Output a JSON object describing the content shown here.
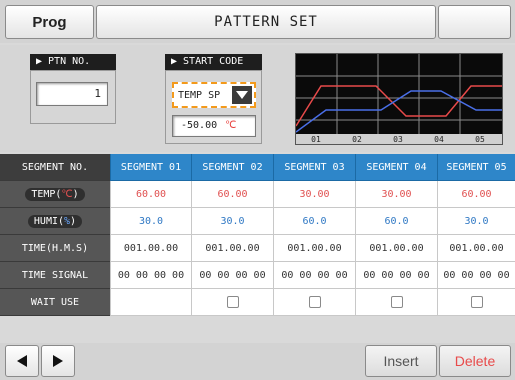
{
  "header": {
    "prog_label": "Prog",
    "title": "PATTERN SET"
  },
  "ptn": {
    "label": "▶ PTN NO.",
    "value": "1"
  },
  "start_code": {
    "label": "▶ START CODE",
    "selected": "TEMP SP",
    "temp_value": "-50.00",
    "temp_unit": "℃"
  },
  "graph": {
    "x_labels": [
      "01",
      "02",
      "03",
      "04",
      "05"
    ],
    "colors": {
      "temp": "#e84a4a",
      "humi": "#4a6fe8",
      "grid": "#8a8a8a"
    }
  },
  "table": {
    "row_labels": {
      "segment_no": "SEGMENT NO.",
      "temp_prefix": "TEMP(",
      "temp_unit": "℃",
      "temp_suffix": ")",
      "humi_prefix": "HUMI(",
      "humi_unit": "%",
      "humi_suffix": ")",
      "time": "TIME(H.M.S)",
      "time_signal": "TIME SIGNAL",
      "wait_use": "WAIT USE"
    },
    "segments": [
      "SEGMENT 01",
      "SEGMENT 02",
      "SEGMENT 03",
      "SEGMENT 04",
      "SEGMENT 05"
    ],
    "temp": [
      "60.00",
      "60.00",
      "30.00",
      "30.00",
      "60.00"
    ],
    "humi": [
      "30.0",
      "30.0",
      "60.0",
      "60.0",
      "30.0"
    ],
    "time": [
      "001.00.00",
      "001.00.00",
      "001.00.00",
      "001.00.00",
      "001.00.00"
    ],
    "time_signal": [
      "00 00 00 00",
      "00 00 00 00",
      "00 00 00 00",
      "00 00 00 00",
      "00 00 00 00"
    ]
  },
  "footer": {
    "insert_label": "Insert",
    "delete_label": "Delete"
  },
  "colors": {
    "accent_blue": "#2e86c9",
    "temp_red": "#e05050",
    "humi_blue": "#2f78c4",
    "select_orange": "#f39a1c"
  }
}
